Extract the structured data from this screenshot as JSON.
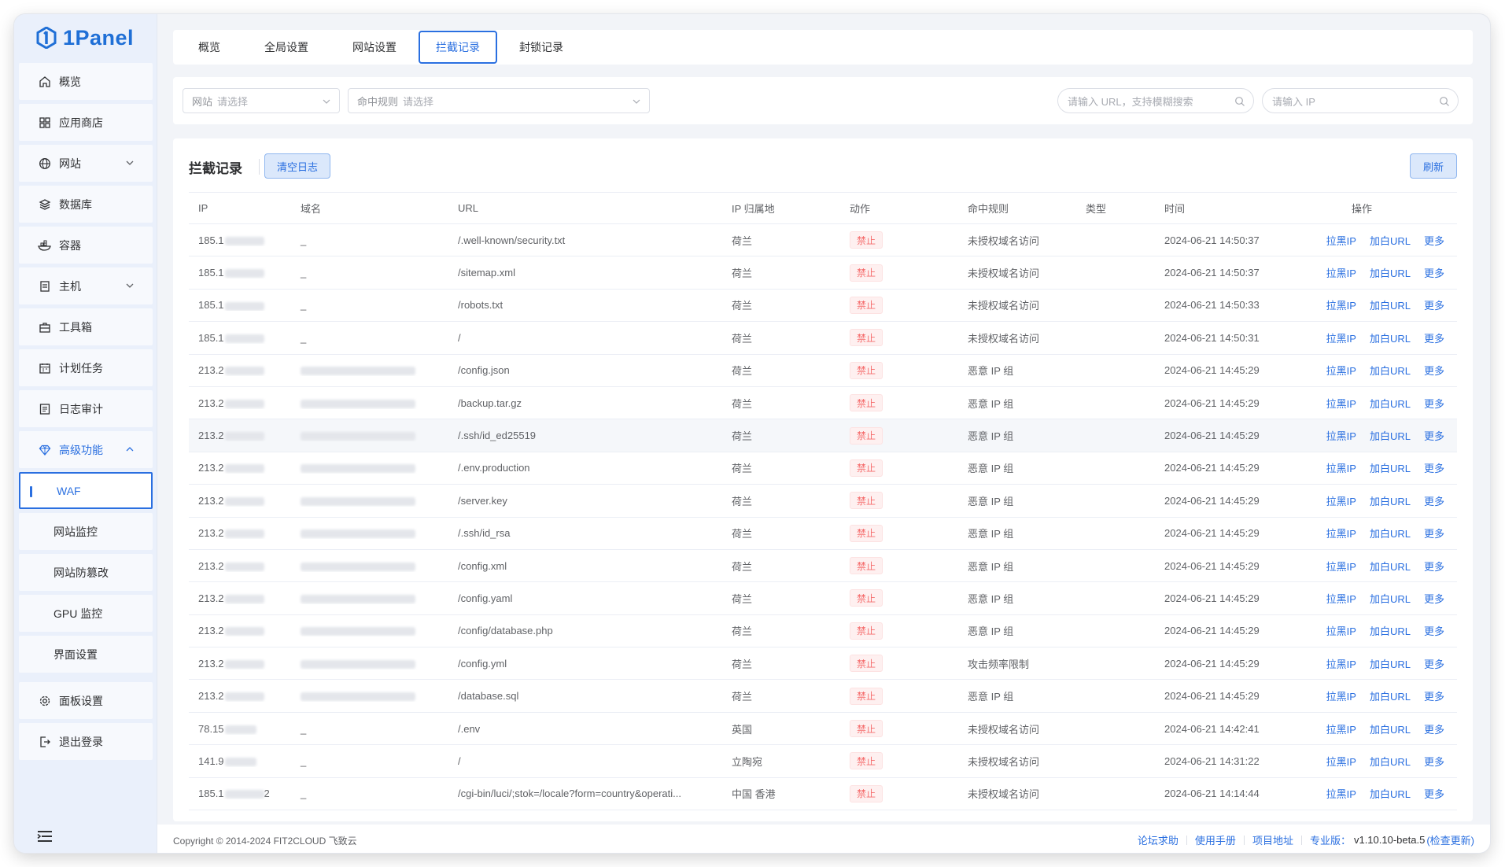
{
  "app": {
    "name": "1Panel"
  },
  "sidebar": {
    "items": [
      {
        "key": "overview",
        "label": "概览",
        "icon": "home-icon"
      },
      {
        "key": "appstore",
        "label": "应用商店",
        "icon": "grid-icon"
      },
      {
        "key": "website",
        "label": "网站",
        "icon": "globe-icon",
        "expandable": true
      },
      {
        "key": "database",
        "label": "数据库",
        "icon": "layers-icon"
      },
      {
        "key": "container",
        "label": "容器",
        "icon": "ship-icon"
      },
      {
        "key": "host",
        "label": "主机",
        "icon": "server-icon",
        "expandable": true
      },
      {
        "key": "toolbox",
        "label": "工具箱",
        "icon": "toolbox-icon"
      },
      {
        "key": "cron",
        "label": "计划任务",
        "icon": "calendar-icon"
      },
      {
        "key": "log",
        "label": "日志审计",
        "icon": "log-icon"
      },
      {
        "key": "advanced",
        "label": "高级功能",
        "icon": "diamond-icon",
        "expandable": true,
        "expanded": true
      },
      {
        "key": "waf",
        "label": "WAF",
        "sub": true,
        "active": true
      },
      {
        "key": "monitor",
        "label": "网站监控",
        "sub": true
      },
      {
        "key": "tamper",
        "label": "网站防篡改",
        "sub": true
      },
      {
        "key": "gpu",
        "label": "GPU 监控",
        "sub": true
      },
      {
        "key": "ui",
        "label": "界面设置",
        "sub": true
      },
      {
        "key": "settings",
        "label": "面板设置",
        "icon": "gear-icon"
      },
      {
        "key": "logout",
        "label": "退出登录",
        "icon": "logout-icon"
      }
    ]
  },
  "tabs": [
    {
      "label": "概览"
    },
    {
      "label": "全局设置"
    },
    {
      "label": "网站设置"
    },
    {
      "label": "拦截记录",
      "active": true
    },
    {
      "label": "封锁记录"
    }
  ],
  "filters": {
    "website": {
      "label": "网站",
      "placeholder": "请选择"
    },
    "rule": {
      "label": "命中规则",
      "placeholder": "请选择"
    },
    "url_search": {
      "placeholder": "请输入 URL，支持模糊搜索"
    },
    "ip_search": {
      "placeholder": "请输入 IP"
    }
  },
  "panel": {
    "title": "拦截记录",
    "clear_button": "清空日志",
    "refresh_button": "刷新"
  },
  "table": {
    "columns": [
      "IP",
      "域名",
      "URL",
      "IP 归属地",
      "动作",
      "命中规则",
      "类型",
      "时间",
      "操作"
    ],
    "ops": {
      "blacklist": "拉黑IP",
      "whitelist": "加白URL",
      "more": "更多"
    },
    "rows": [
      {
        "ip": "185.1",
        "ip_suffix": "",
        "domain": "_",
        "url": "/.well-known/security.txt",
        "geo": "荷兰",
        "action": "禁止",
        "rule": "未授权域名访问",
        "type": "",
        "time": "2024-06-21 14:50:37"
      },
      {
        "ip": "185.1",
        "ip_suffix": "",
        "domain": "_",
        "url": "/sitemap.xml",
        "geo": "荷兰",
        "action": "禁止",
        "rule": "未授权域名访问",
        "type": "",
        "time": "2024-06-21 14:50:37"
      },
      {
        "ip": "185.1",
        "ip_suffix": "",
        "domain": "_",
        "url": "/robots.txt",
        "geo": "荷兰",
        "action": "禁止",
        "rule": "未授权域名访问",
        "type": "",
        "time": "2024-06-21 14:50:33"
      },
      {
        "ip": "185.1",
        "ip_suffix": "",
        "domain": "_",
        "url": "/",
        "geo": "荷兰",
        "action": "禁止",
        "rule": "未授权域名访问",
        "type": "",
        "time": "2024-06-21 14:50:31"
      },
      {
        "ip": "213.2",
        "ip_suffix": "",
        "domain": "",
        "url": "/config.json",
        "geo": "荷兰",
        "action": "禁止",
        "rule": "恶意 IP 组",
        "type": "",
        "time": "2024-06-21 14:45:29"
      },
      {
        "ip": "213.2",
        "ip_suffix": "",
        "domain": "",
        "url": "/backup.tar.gz",
        "geo": "荷兰",
        "action": "禁止",
        "rule": "恶意 IP 组",
        "type": "",
        "time": "2024-06-21 14:45:29"
      },
      {
        "ip": "213.2",
        "ip_suffix": "",
        "domain": "",
        "url": "/.ssh/id_ed25519",
        "geo": "荷兰",
        "action": "禁止",
        "rule": "恶意 IP 组",
        "type": "",
        "time": "2024-06-21 14:45:29",
        "highlight": true
      },
      {
        "ip": "213.2",
        "ip_suffix": "",
        "domain": "",
        "url": "/.env.production",
        "geo": "荷兰",
        "action": "禁止",
        "rule": "恶意 IP 组",
        "type": "",
        "time": "2024-06-21 14:45:29"
      },
      {
        "ip": "213.2",
        "ip_suffix": "",
        "domain": "",
        "url": "/server.key",
        "geo": "荷兰",
        "action": "禁止",
        "rule": "恶意 IP 组",
        "type": "",
        "time": "2024-06-21 14:45:29"
      },
      {
        "ip": "213.2",
        "ip_suffix": "",
        "domain": "",
        "url": "/.ssh/id_rsa",
        "geo": "荷兰",
        "action": "禁止",
        "rule": "恶意 IP 组",
        "type": "",
        "time": "2024-06-21 14:45:29"
      },
      {
        "ip": "213.2",
        "ip_suffix": "",
        "domain": "",
        "url": "/config.xml",
        "geo": "荷兰",
        "action": "禁止",
        "rule": "恶意 IP 组",
        "type": "",
        "time": "2024-06-21 14:45:29"
      },
      {
        "ip": "213.2",
        "ip_suffix": "",
        "domain": "",
        "url": "/config.yaml",
        "geo": "荷兰",
        "action": "禁止",
        "rule": "恶意 IP 组",
        "type": "",
        "time": "2024-06-21 14:45:29"
      },
      {
        "ip": "213.2",
        "ip_suffix": "",
        "domain": "",
        "url": "/config/database.php",
        "geo": "荷兰",
        "action": "禁止",
        "rule": "恶意 IP 组",
        "type": "",
        "time": "2024-06-21 14:45:29"
      },
      {
        "ip": "213.2",
        "ip_suffix": "",
        "domain": "",
        "url": "/config.yml",
        "geo": "荷兰",
        "action": "禁止",
        "rule": "攻击频率限制",
        "type": "",
        "time": "2024-06-21 14:45:29"
      },
      {
        "ip": "213.2",
        "ip_suffix": "",
        "domain": "",
        "url": "/database.sql",
        "geo": "荷兰",
        "action": "禁止",
        "rule": "恶意 IP 组",
        "type": "",
        "time": "2024-06-21 14:45:29"
      },
      {
        "ip": "78.15",
        "ip_suffix": "",
        "domain": "_",
        "url": "/.env",
        "geo": "英国",
        "action": "禁止",
        "rule": "未授权域名访问",
        "type": "",
        "time": "2024-06-21 14:42:41"
      },
      {
        "ip": "141.9",
        "ip_suffix": "",
        "domain": "_",
        "url": "/",
        "geo": "立陶宛",
        "action": "禁止",
        "rule": "未授权域名访问",
        "type": "",
        "time": "2024-06-21 14:31:22"
      },
      {
        "ip": "185.1",
        "ip_suffix": "2",
        "domain": "_",
        "url": "/cgi-bin/luci/;stok=/locale?form=country&operati...",
        "geo": "中国 香港",
        "action": "禁止",
        "rule": "未授权域名访问",
        "type": "",
        "time": "2024-06-21 14:14:44"
      }
    ]
  },
  "footer": {
    "copyright": "Copyright © 2014-2024 FIT2CLOUD 飞致云",
    "links": [
      "论坛求助",
      "使用手册",
      "项目地址"
    ],
    "edition_label": "专业版：",
    "version": "v1.10.10-beta.5",
    "check_update": "(检查更新)"
  },
  "colors": {
    "accent": "#2a6fe0",
    "danger": "#f56c6c",
    "sidebar_bg": "#eaf0fb"
  }
}
